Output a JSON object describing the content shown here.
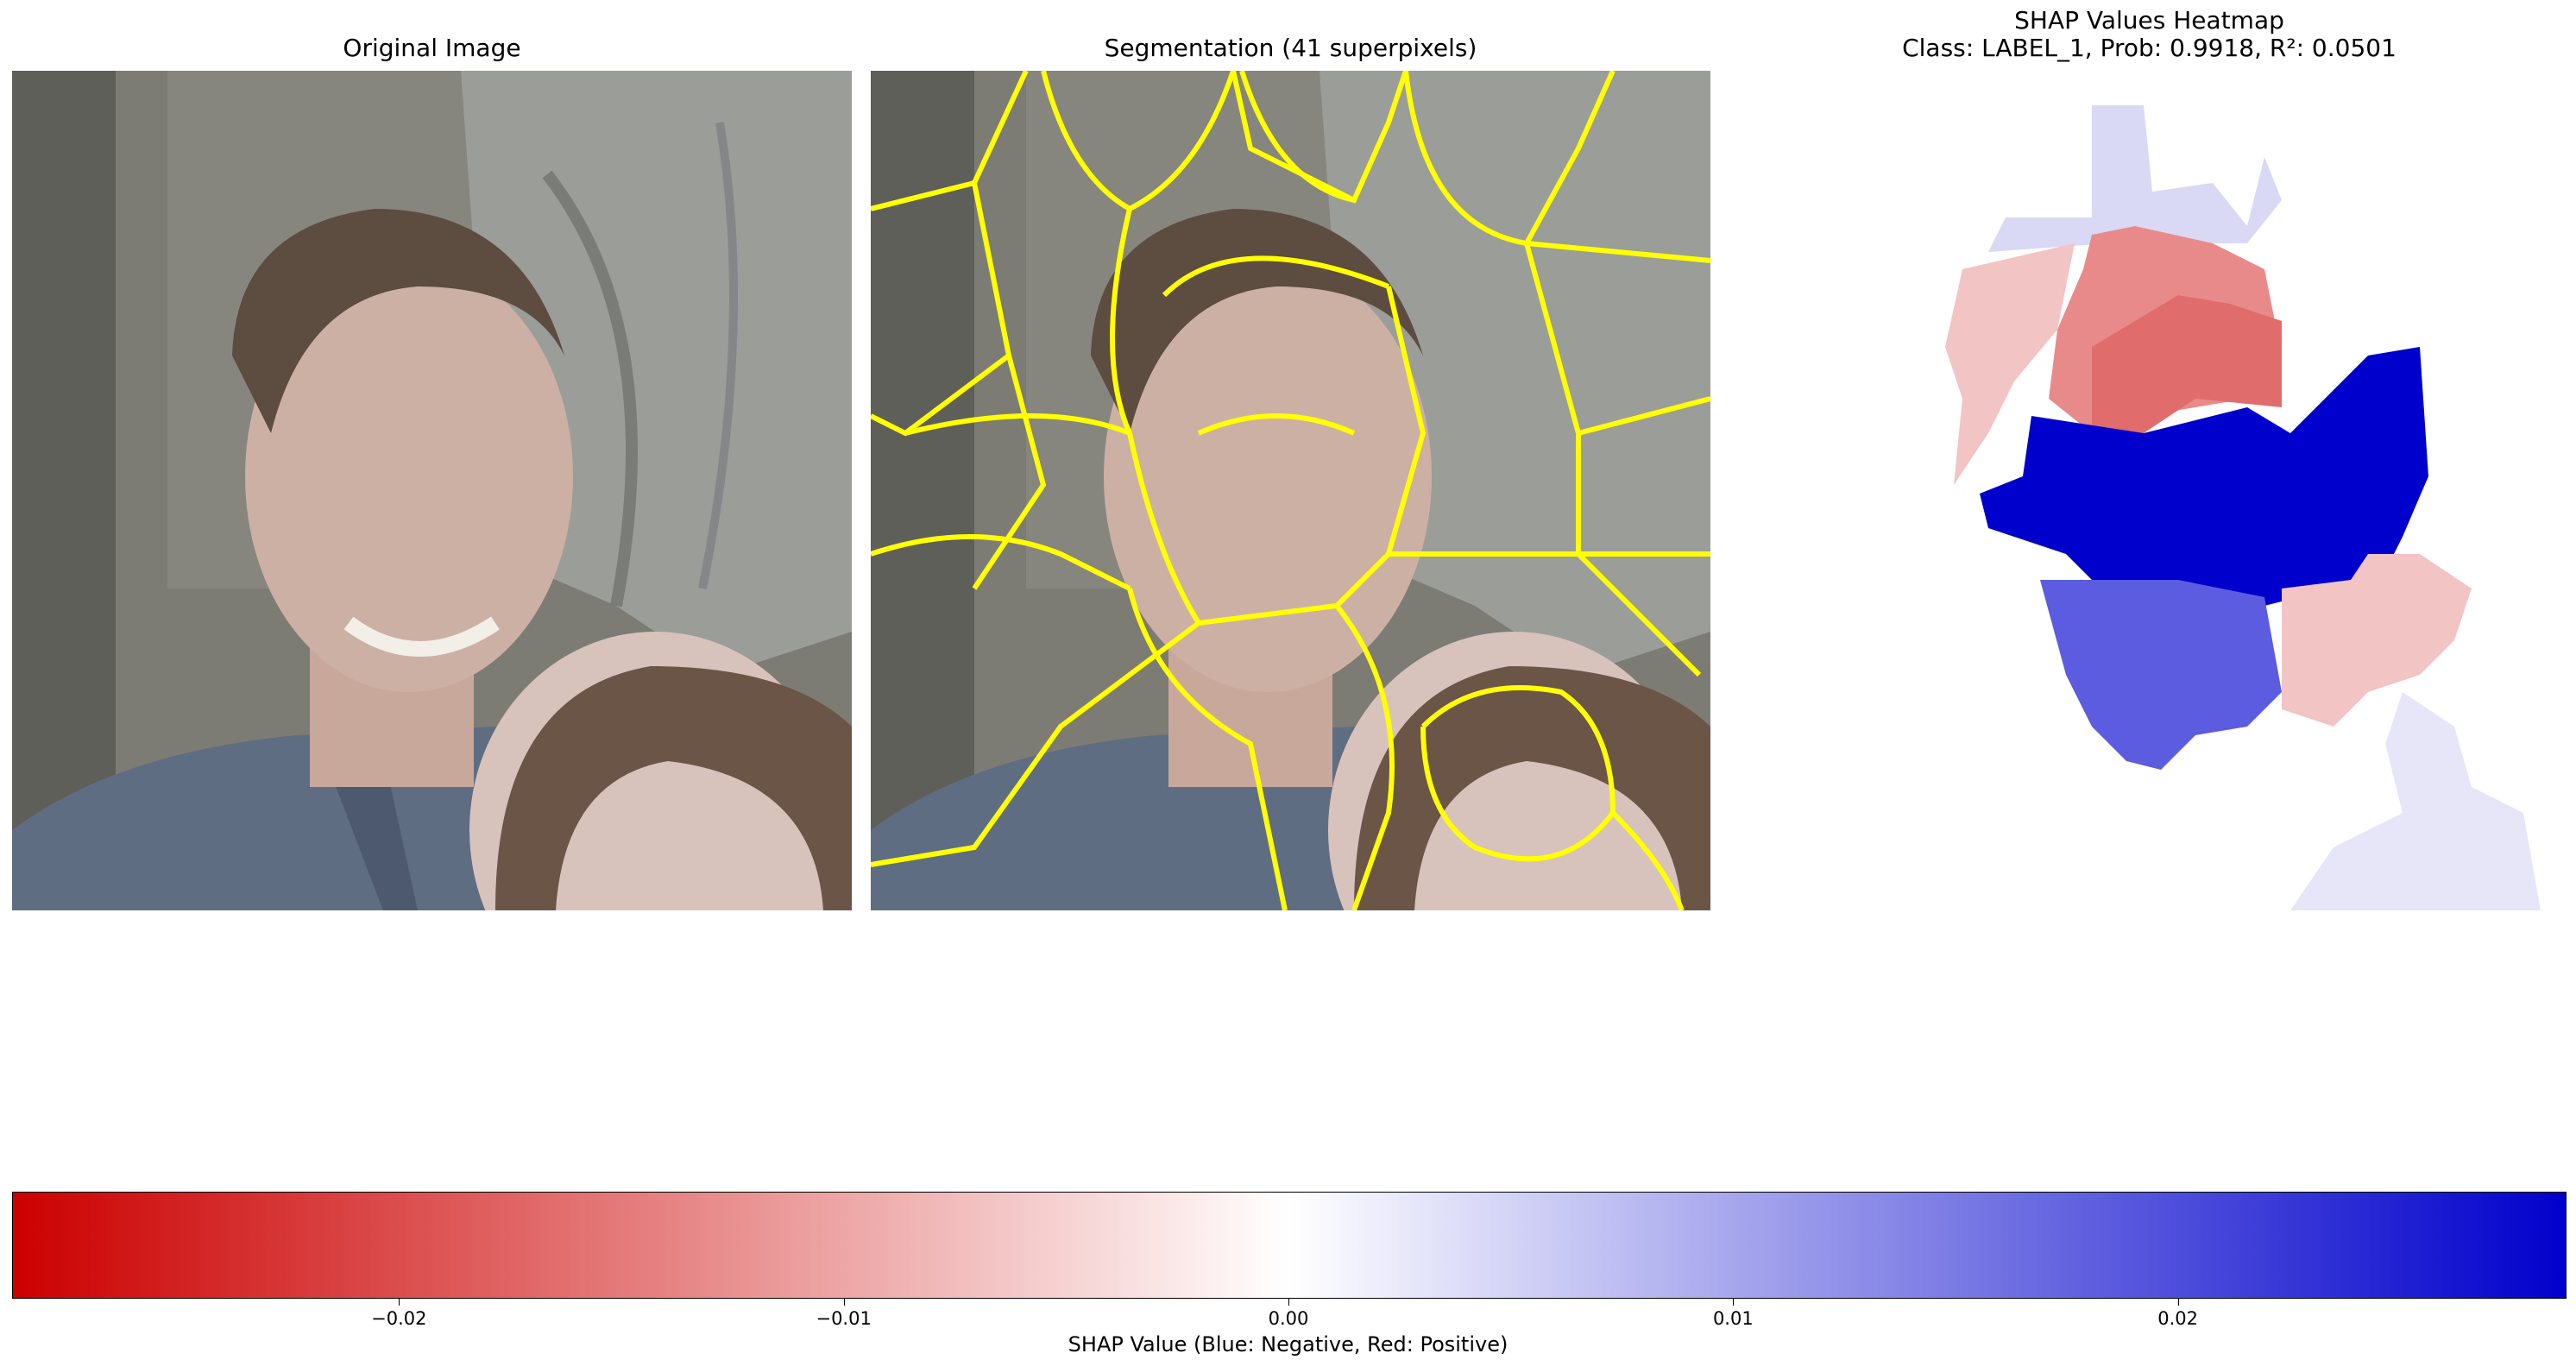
{
  "panels": {
    "original": {
      "title": "Original Image"
    },
    "segmentation": {
      "title": "Segmentation (41 superpixels)"
    },
    "heatmap": {
      "title_line1": "SHAP Values Heatmap",
      "title_line2": "Class: LABEL_1, Prob: 0.9918, R²: 0.0501"
    }
  },
  "colors": {
    "negative": "#0000cc",
    "positive": "#cc0000",
    "neutral": "#ffffff",
    "segment_boundary": "#ffff00"
  },
  "chart_data": {
    "type": "heatmap",
    "colorbar": {
      "label": "SHAP Value (Blue: Negative, Red: Positive)",
      "range": [
        -0.0287,
        0.0287
      ],
      "ticks": [
        -0.02,
        -0.01,
        0.0,
        0.01,
        0.02
      ],
      "tick_labels": [
        "−0.02",
        "−0.01",
        "0.00",
        "0.01",
        "0.02"
      ],
      "colormap": [
        "#cc0000",
        "#ffffff",
        "#0000cc"
      ]
    }
  }
}
